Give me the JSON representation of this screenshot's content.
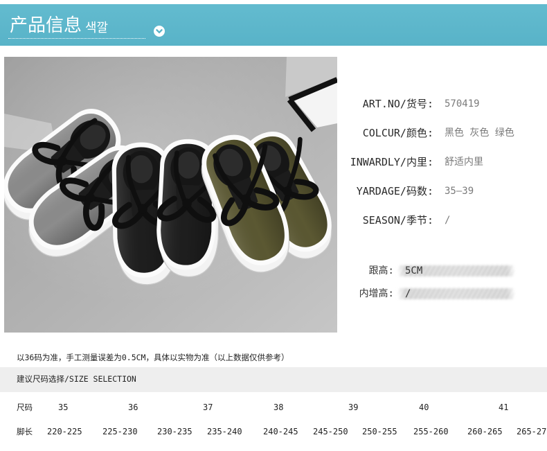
{
  "header": {
    "title": "产品信息",
    "subtitle": "색깔",
    "toggle_icon": "chevron-down-icon"
  },
  "colors": {
    "header_bg_top": "#63bbcf",
    "header_bg": "#58b3c8",
    "label_text": "#2a2a2a",
    "value_text": "#7a7a7a",
    "band_bg": "#eeeeee",
    "shoe_gray": "#8c8c8c",
    "shoe_black": "#1e1e1e",
    "shoe_olive": "#5b5832"
  },
  "specs": [
    {
      "label": "ART.NO/货号:",
      "value": "570419"
    },
    {
      "label": "COLCUR/颜色:",
      "value": "黑色 灰色 绿色"
    },
    {
      "label": "INWARDLY/内里:",
      "value": "舒适内里"
    },
    {
      "label": "YARDAGE/码数:",
      "value": "35—39"
    },
    {
      "label": "SEASON/季节:",
      "value": "/"
    }
  ],
  "extra_specs": [
    {
      "label": "跟高:",
      "value": "5CM"
    },
    {
      "label": "内增高:",
      "value": "/"
    }
  ],
  "note": "以36码为准，手工测量误差为0.5CM，具体以实物为准（以上数据仅供参考）",
  "size_table": {
    "title": "建议尺码选择/SIZE SELECTION",
    "size_label": "尺码",
    "sizes": [
      "35",
      "36",
      "37",
      "38",
      "39",
      "40",
      "41"
    ],
    "length_label": "脚长",
    "lengths": [
      "220-225",
      "225-230",
      "230-235",
      "235-240",
      "240-245",
      "245-250",
      "250-255",
      "255-260",
      "260-265",
      "265-27"
    ]
  }
}
